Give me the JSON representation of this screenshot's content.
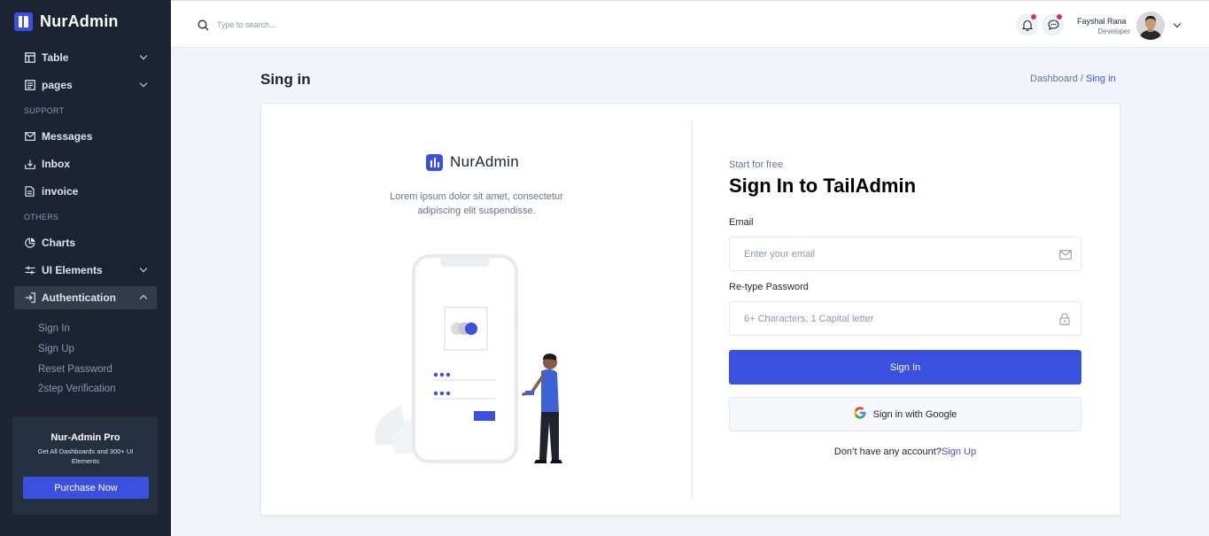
{
  "sidebar": {
    "logo": "NurAdmin",
    "items": [
      {
        "label": "Table"
      },
      {
        "label": "pages"
      },
      {
        "label": "Messages"
      },
      {
        "label": "Inbox"
      },
      {
        "label": "invoice"
      },
      {
        "label": "Charts"
      },
      {
        "label": "UI Elements"
      },
      {
        "label": "Authentication"
      }
    ],
    "sections": {
      "support": "SUPPORT",
      "others": "OTHERS"
    },
    "auth_sub": [
      "Sign In",
      "Sign Up",
      "Reset Password",
      "2step Verification"
    ],
    "promo": {
      "title": "Nur-Admin Pro",
      "desc": "Get All Dashboards and 300+ UI Elements",
      "button": "Purchase Now"
    }
  },
  "header": {
    "search_placeholder": "Type to search...",
    "user_name": "Fayshal Rana",
    "user_role": "Developer"
  },
  "page": {
    "title": "Sing in",
    "breadcrumb_parent": "Dashboard /",
    "breadcrumb_current": "Sing in"
  },
  "left_panel": {
    "brand": "NurAdmin",
    "desc": "Lorem ipsum dolor sit amet, consectetur adipiscing elit suspendisse."
  },
  "form": {
    "kicker": "Start for free",
    "title": "Sign In to TailAdmin",
    "email_label": "Email",
    "email_placeholder": "Enter your email",
    "password_label": "Re-type Password",
    "password_placeholder": "6+ Characters, 1 Capital letter",
    "submit": "Sign In",
    "google": "Sign in with Google",
    "no_account": "Don’t have any account?",
    "signup_link": "Sign Up"
  },
  "colors": {
    "primary": "#3c50e0",
    "sidebar": "#1c2434",
    "background": "#f1f5f9"
  }
}
